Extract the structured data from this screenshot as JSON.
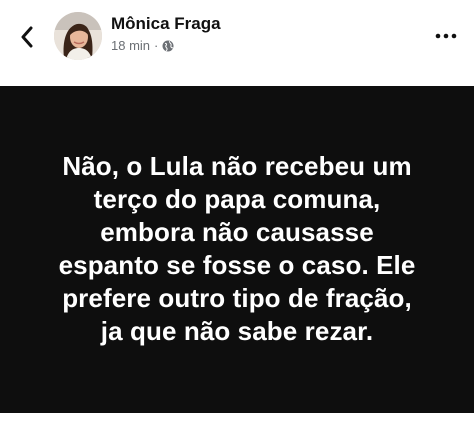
{
  "header": {
    "back_icon": "chevron-left-icon",
    "author_name": "Mônica Fraga",
    "timestamp": "18 min",
    "separator": "·",
    "privacy_icon": "globe-icon",
    "more_icon": "more-horizontal-icon"
  },
  "post": {
    "background_color": "#0e0e0e",
    "text_color": "#ffffff",
    "text": "Não, o Lula não recebeu um\nterço do papa comuna,\nembora não causasse\nespanto se fosse o caso. Ele\nprefere outro tipo de fração,\nja que não sabe rezar."
  }
}
